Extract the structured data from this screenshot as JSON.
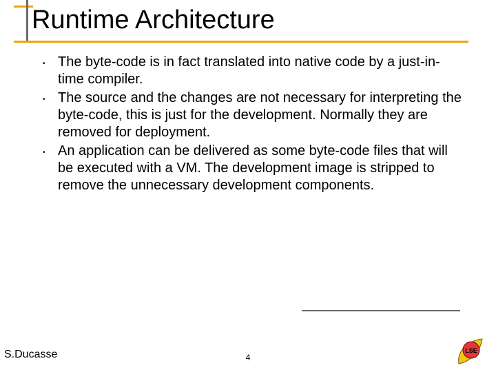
{
  "title": "Runtime Architecture",
  "bullets": [
    "The byte-code is in fact translated into native code by a just-in-time compiler.",
    "The source and the changes are not necessary for interpreting the byte-code, this is just for the development. Normally they are removed for deployment.",
    "An application can be delivered as some byte-code files that will be executed with a VM. The development image is stripped to remove the unnecessary development components."
  ],
  "author": "S.Ducasse",
  "page_number": "4",
  "logo_text": "LSE"
}
